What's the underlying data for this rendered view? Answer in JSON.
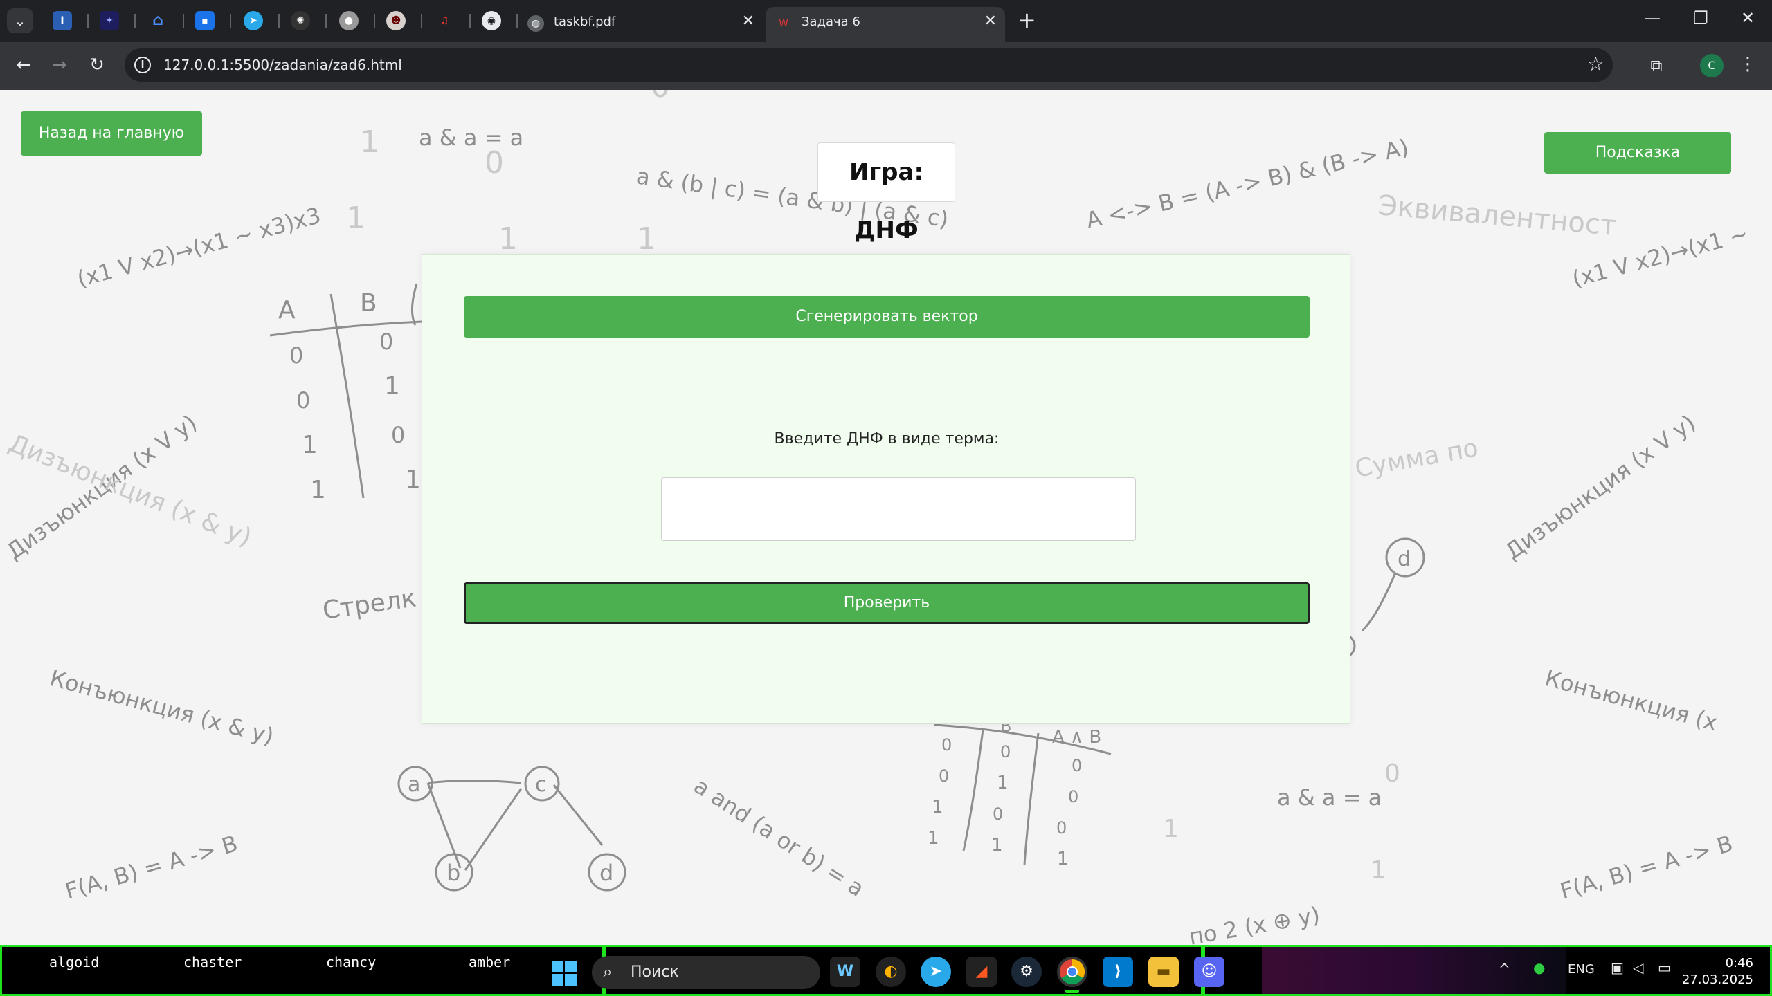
{
  "browser": {
    "tabs": [
      {
        "title": "taskbf.pdf",
        "icon": "globe-icon",
        "active": false
      },
      {
        "title": "Задача 6",
        "icon": "site-favicon",
        "active": true
      }
    ],
    "pinned_tabs": [
      "isu-icon",
      "sparkle-icon",
      "home-icon",
      "chat-icon",
      "telegram-icon",
      "chatgpt-icon",
      "profile-icon",
      "mask-icon",
      "music-icon",
      "github-icon"
    ],
    "url": "127.0.0.1:5500/zadania/zad6.html",
    "profile_initial": "C"
  },
  "page": {
    "back_button": "Назад на главную",
    "hint_button": "Подсказка",
    "title": "Игра: ДНФ",
    "generate_button": "Сгенерировать вектор",
    "input_label": "Введите ДНФ в виде терма:",
    "input_value": "",
    "check_button": "Проверить",
    "background_texts": {
      "absorb1": "a & a = a",
      "distrib": "a & (b | c) = (a & b) | (a & c)",
      "equiv": "A <-> B = (A -> B) & (B -> A)",
      "equiv_word": "Эквивалентност",
      "formula_left": "(x1 V x2)→(x1 ~ x3)x3",
      "formula_right": "(x1 V x2)→(x1 ~",
      "disj_left": "Дизъюнкция (x V y)",
      "disj_right": "Дизъюнкция (x V y)",
      "strelka": "Стрелк",
      "conj_left": "Конъюнкция (x & y)",
      "conj_right": "Конъюнкция (x",
      "absorb2": "a and (a or b) = a",
      "absorb3": "a & a = a",
      "impl_left": "F(A, B) = A -> B",
      "impl_right": "F(A, B) = A -> B",
      "sum_mod2": "Сумма по",
      "sum_bottom": "по 2 (x ⊕ y)",
      "table1_head": [
        "A",
        "B"
      ],
      "table1_rows": [
        [
          "0",
          "0"
        ],
        [
          "0",
          "1"
        ],
        [
          "1",
          "0"
        ],
        [
          "1",
          "1"
        ]
      ],
      "table2_head": [
        "B",
        "A ∧ B"
      ],
      "table2_rows": [
        [
          "0",
          "0",
          "0"
        ],
        [
          "0",
          "1",
          "0"
        ],
        [
          "1",
          "0",
          "0"
        ],
        [
          "1",
          "1",
          "1"
        ]
      ],
      "graph_nodes": [
        "a",
        "c",
        "b",
        "d"
      ],
      "node_d": "d"
    }
  },
  "taskbar": {
    "workspaces": [
      "algoid",
      "chaster",
      "chancy",
      "amber"
    ],
    "search_placeholder": "Поиск",
    "language": "ENG",
    "time": "0:46",
    "date": "27.03.2025"
  },
  "colors": {
    "primary_green": "#4caf50",
    "card_bg": "#f1fdef",
    "taskbar_border": "#1ee31e"
  }
}
